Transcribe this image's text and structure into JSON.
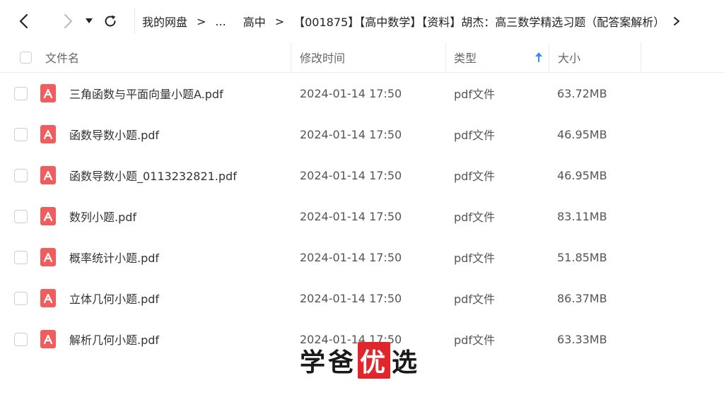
{
  "toolbar": {
    "back_icon": "chevron-left-icon",
    "forward_icon": "chevron-right-icon",
    "dropdown_icon": "caret-down-icon",
    "refresh_icon": "refresh-icon"
  },
  "breadcrumb": {
    "root": "我的网盘",
    "ellipsis": "...",
    "level1": "高中",
    "current": "【001875】【高中数学】【资料】胡杰：高三数学精选习题（配答案解析）",
    "separator": ">",
    "more_icon": "chevron-right-icon"
  },
  "table": {
    "columns": {
      "name": "文件名",
      "modified": "修改时间",
      "type": "类型",
      "size": "大小"
    },
    "sort_icon": "arrow-up-icon",
    "sort_color": "#2f8cff",
    "rows": [
      {
        "name": "三角函数与平面向量小题A.pdf",
        "modified": "2024-01-14 17:50",
        "type": "pdf文件",
        "size": "63.72MB"
      },
      {
        "name": "函数导数小题.pdf",
        "modified": "2024-01-14 17:50",
        "type": "pdf文件",
        "size": "46.95MB"
      },
      {
        "name": "函数导数小题_0113232821.pdf",
        "modified": "2024-01-14 17:50",
        "type": "pdf文件",
        "size": "46.95MB"
      },
      {
        "name": "数列小题.pdf",
        "modified": "2024-01-14 17:50",
        "type": "pdf文件",
        "size": "83.11MB"
      },
      {
        "name": "概率统计小题.pdf",
        "modified": "2024-01-14 17:50",
        "type": "pdf文件",
        "size": "51.85MB"
      },
      {
        "name": "立体几何小题.pdf",
        "modified": "2024-01-14 17:50",
        "type": "pdf文件",
        "size": "86.37MB"
      },
      {
        "name": "解析几何小题.pdf",
        "modified": "2024-01-14 17:50",
        "type": "pdf文件",
        "size": "63.33MB"
      }
    ],
    "file_icon": "pdf-file-icon",
    "file_icon_color": "#f25c5c"
  },
  "watermark": {
    "part1": "学爸",
    "highlight": "优",
    "part2": "选",
    "highlight_color": "#e0262b"
  }
}
